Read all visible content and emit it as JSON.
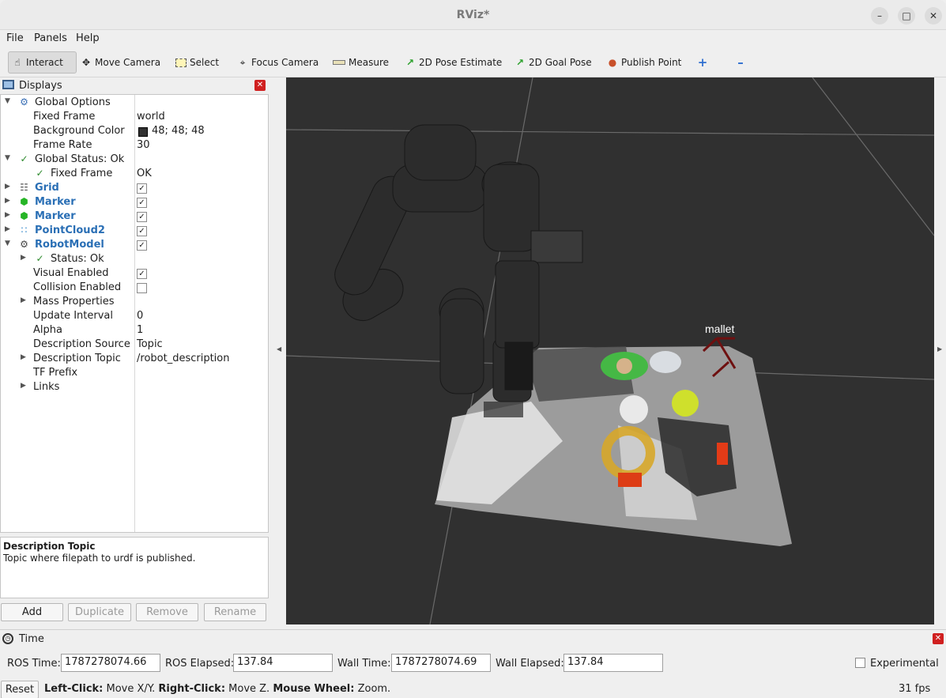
{
  "window": {
    "title": "RViz*"
  },
  "menu": [
    "File",
    "Panels",
    "Help"
  ],
  "toolbar": {
    "interact": "Interact",
    "move_camera": "Move Camera",
    "select": "Select",
    "focus_camera": "Focus Camera",
    "measure": "Measure",
    "pose_estimate": "2D Pose Estimate",
    "goal_pose": "2D Goal Pose",
    "publish_point": "Publish Point"
  },
  "displays": {
    "title": "Displays",
    "global_options": "Global Options",
    "fixed_frame_label": "Fixed Frame",
    "fixed_frame_value": "world",
    "background_color_label": "Background Color",
    "background_color_value": "48; 48; 48",
    "background_color_hex": "#303030",
    "frame_rate_label": "Frame Rate",
    "frame_rate_value": "30",
    "global_status": "Global Status: Ok",
    "gs_fixed_frame_label": "Fixed Frame",
    "gs_fixed_frame_value": "OK",
    "grid": "Grid",
    "marker1": "Marker",
    "marker2": "Marker",
    "pointcloud": "PointCloud2",
    "robotmodel": "RobotModel",
    "status_ok": "Status: Ok",
    "visual_enabled": "Visual Enabled",
    "collision_enabled": "Collision Enabled",
    "mass_properties": "Mass Properties",
    "update_interval_label": "Update Interval",
    "update_interval_value": "0",
    "alpha_label": "Alpha",
    "alpha_value": "1",
    "desc_source_label": "Description Source",
    "desc_source_value": "Topic",
    "desc_topic_label": "Description Topic",
    "desc_topic_value": "/robot_description",
    "tf_prefix": "TF Prefix",
    "links": "Links"
  },
  "description_box": {
    "title": "Description Topic",
    "text": "Topic where filepath to urdf is published."
  },
  "buttons": {
    "add": "Add",
    "duplicate": "Duplicate",
    "remove": "Remove",
    "rename": "Rename"
  },
  "viewport": {
    "marker_label": "mallet"
  },
  "time": {
    "title": "Time",
    "ros_time_label": "ROS Time:",
    "ros_time_value": "1787278074.66",
    "ros_elapsed_label": "ROS Elapsed:",
    "ros_elapsed_value": "137.84",
    "wall_time_label": "Wall Time:",
    "wall_time_value": "1787278074.69",
    "wall_elapsed_label": "Wall Elapsed:",
    "wall_elapsed_value": "137.84",
    "experimental": "Experimental"
  },
  "statusbar": {
    "reset": "Reset",
    "left_click": "Left-Click:",
    "left_click_desc": "Move X/Y.",
    "right_click": "Right-Click:",
    "right_click_desc": "Move Z.",
    "mouse_wheel": "Mouse Wheel:",
    "mouse_wheel_desc": "Zoom.",
    "fps": "31 fps"
  }
}
